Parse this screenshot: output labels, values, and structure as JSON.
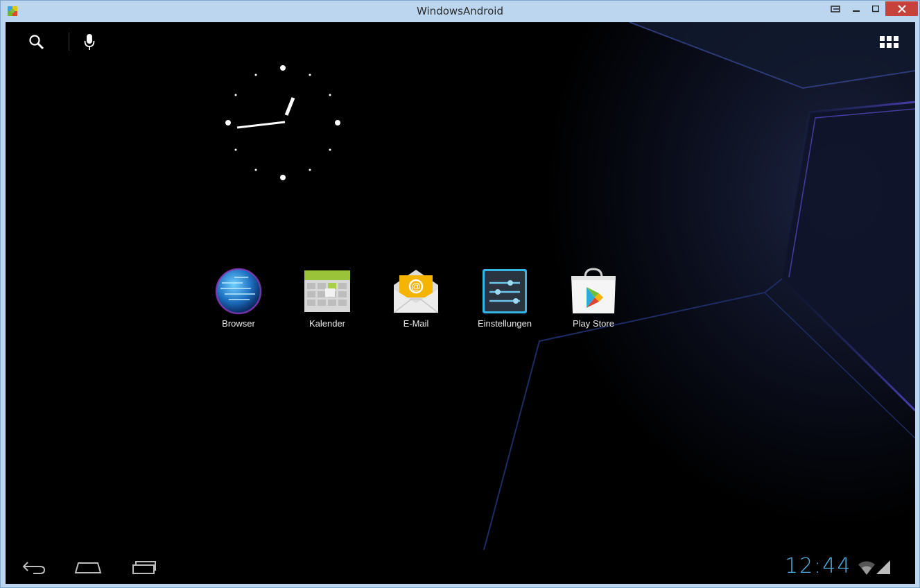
{
  "window": {
    "title": "WindowsAndroid"
  },
  "launcher": {
    "apps": [
      {
        "label": "Browser",
        "icon": "browser-globe-icon"
      },
      {
        "label": "Kalender",
        "icon": "calendar-icon"
      },
      {
        "label": "E-Mail",
        "icon": "email-icon"
      },
      {
        "label": "Einstellungen",
        "icon": "settings-icon"
      },
      {
        "label": "Play Store",
        "icon": "play-store-icon"
      }
    ]
  },
  "status": {
    "time": "12:44"
  },
  "colors": {
    "accent": "#4fb0e6",
    "wallpaper": "#05070d",
    "close_button": "#c7423a"
  }
}
